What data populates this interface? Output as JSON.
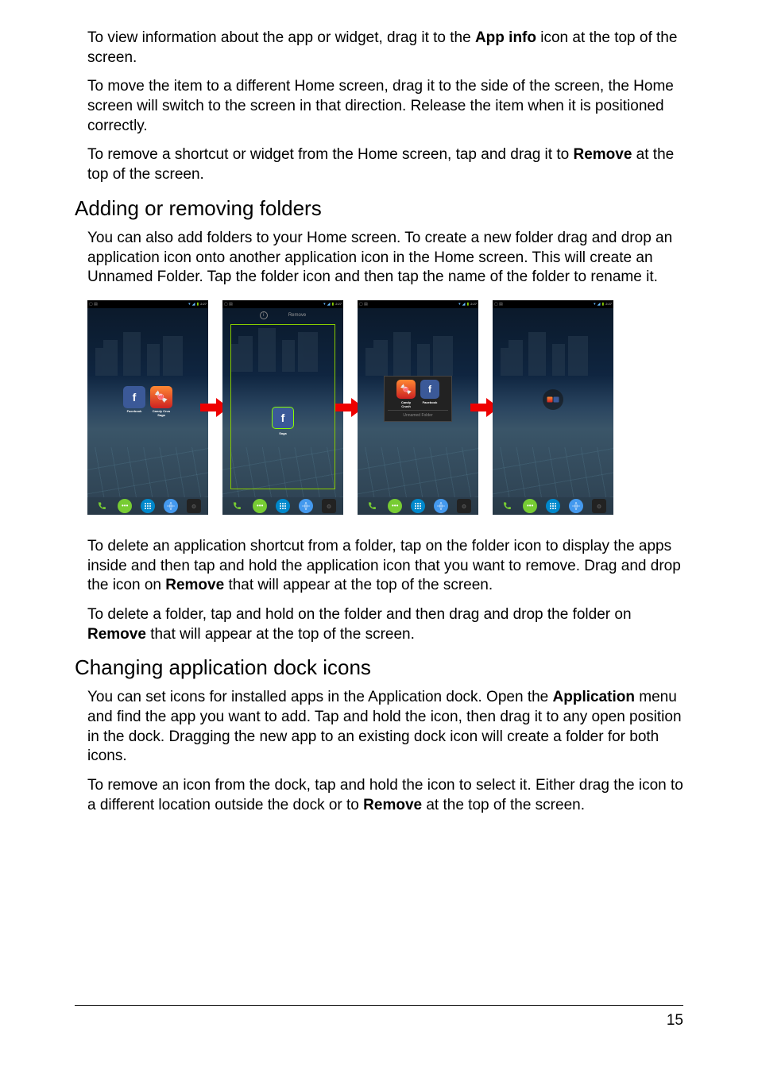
{
  "paragraphs": {
    "p1_a": "To view information about the app or widget, drag it to the ",
    "p1_bold": "App info",
    "p1_b": " icon at the top of the screen.",
    "p2": "To move the item to a different Home screen, drag it to the side of the screen, the Home screen will switch to the screen in that direction. Release the item when it is positioned correctly.",
    "p3_a": "To remove a shortcut or widget from the Home screen, tap and drag it to ",
    "p3_bold": "Remove",
    "p3_b": " at the top of the screen.",
    "p4": "You can also add folders to your Home screen. To create a new folder drag and drop an application icon onto another application icon in the Home screen. This will create an Unnamed Folder. Tap the folder icon and then tap the name of the folder to rename it.",
    "p5_a": "To delete an application shortcut from a folder, tap on the folder icon to display the apps inside and then tap and hold the application icon that you want to remove. Drag and drop the icon on ",
    "p5_bold": "Remove",
    "p5_b": " that will appear at the top of the screen.",
    "p6_a": "To delete a folder, tap and hold on the folder and then drag and drop the folder on ",
    "p6_bold": "Remove",
    "p6_b": " that will appear at the top of the screen.",
    "p7_a": "You can set icons for installed apps in the Application dock. Open the ",
    "p7_bold": "Application",
    "p7_b": " menu and find the app you want to add. Tap and hold the icon, then drag it to any open position in the dock. Dragging the new app to an existing dock icon will create a folder for both icons.",
    "p8_a": "To remove an icon from the dock, tap and hold the icon to select it. Either drag the icon to a different location outside the dock or to ",
    "p8_bold": "Remove",
    "p8_b": " at the top of the screen."
  },
  "headings": {
    "h1": "Adding or removing folders",
    "h2": "Changing application dock icons"
  },
  "screens": {
    "status_time": "2:27",
    "remove_label": "Remove",
    "app_facebook": "Facebook",
    "app_candy": "Candy Crus",
    "app_saga": "Saga",
    "app_candy_short": "Candy",
    "app_crush": "Crush",
    "folder_unnamed": "Unnamed Folder",
    "fb_letter": "f",
    "candy_emoji": "🍬"
  },
  "page_number": "15"
}
